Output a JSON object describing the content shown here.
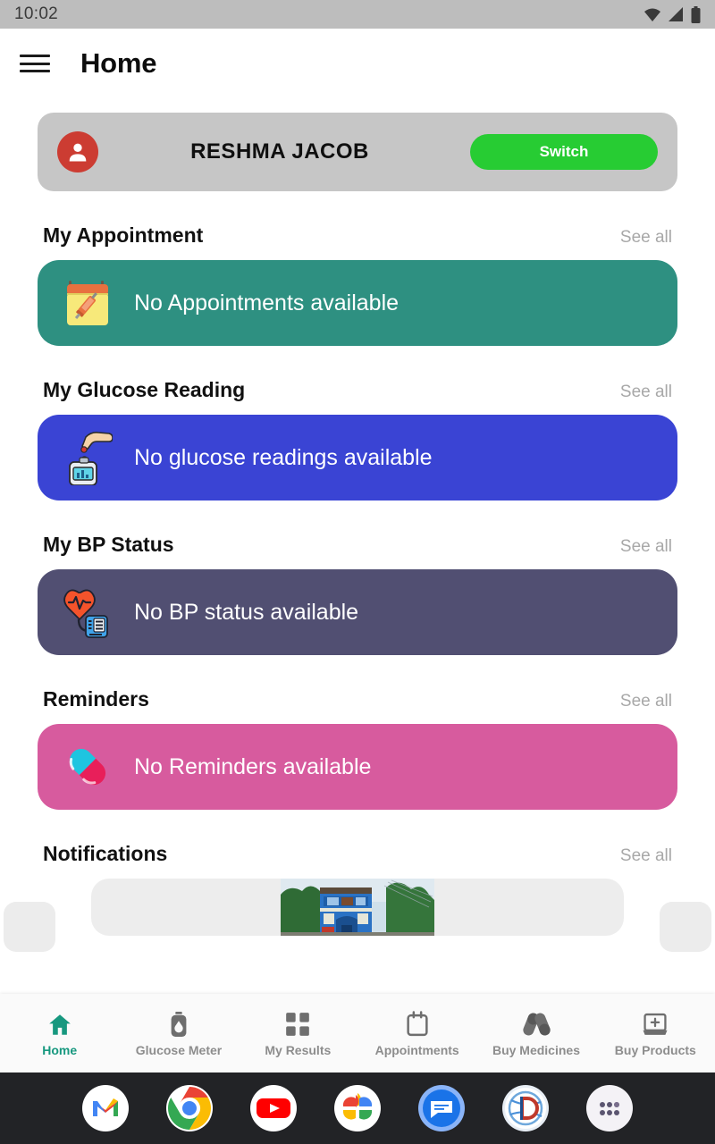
{
  "status_bar": {
    "time": "10:02",
    "icons": [
      "wifi-icon",
      "cellular-signal-icon",
      "battery-icon"
    ]
  },
  "app_bar": {
    "menu_icon": "hamburger-menu-icon",
    "title": "Home"
  },
  "profile": {
    "avatar_icon": "person-avatar-icon",
    "name": "RESHMA JACOB",
    "switch_label": "Switch",
    "switch_color": "#27cc33",
    "avatar_color": "#cc3c32",
    "card_color": "#c6c6c6"
  },
  "see_all_label": "See all",
  "sections": [
    {
      "title": "My Appointment",
      "see_all": "See all",
      "card_text": "No Appointments available",
      "card_color": "#2e9081",
      "icon": "calendar-syringe-icon"
    },
    {
      "title": "My Glucose Reading",
      "see_all": "See all",
      "card_text": "No glucose readings available",
      "card_color": "#3a44d4",
      "icon": "glucose-meter-fingerprick-icon"
    },
    {
      "title": "My BP Status",
      "see_all": "See all",
      "card_text": "No BP status available",
      "card_color": "#514f72",
      "icon": "heart-bp-monitor-icon"
    },
    {
      "title": "Reminders",
      "see_all": "See all",
      "card_text": "No Reminders available",
      "card_color": "#d75b9e",
      "icon": "pill-capsule-icon"
    }
  ],
  "notifications": {
    "title": "Notifications",
    "see_all": "See all",
    "carousel_image": "blue-building-photo"
  },
  "bottom_nav": {
    "active_color": "#17987f",
    "inactive_color": "#8d8d8d",
    "items": [
      {
        "label": "Home",
        "icon": "home-icon",
        "active": true
      },
      {
        "label": "Glucose Meter",
        "icon": "glucose-meter-icon",
        "active": false
      },
      {
        "label": "My Results",
        "icon": "grid-results-icon",
        "active": false
      },
      {
        "label": "Appointments",
        "icon": "calendar-icon",
        "active": false
      },
      {
        "label": "Buy Medicines",
        "icon": "capsules-icon",
        "active": false
      },
      {
        "label": "Buy Products",
        "icon": "medical-case-icon",
        "active": false
      }
    ]
  },
  "dock": {
    "apps": [
      {
        "name": "Gmail",
        "icon": "gmail-icon"
      },
      {
        "name": "Chrome",
        "icon": "chrome-icon"
      },
      {
        "name": "YouTube",
        "icon": "youtube-icon"
      },
      {
        "name": "Google Photos",
        "icon": "google-photos-icon"
      },
      {
        "name": "Messages",
        "icon": "messages-icon"
      },
      {
        "name": "D App",
        "icon": "d-app-icon"
      },
      {
        "name": "App Drawer",
        "icon": "app-drawer-icon"
      }
    ]
  }
}
